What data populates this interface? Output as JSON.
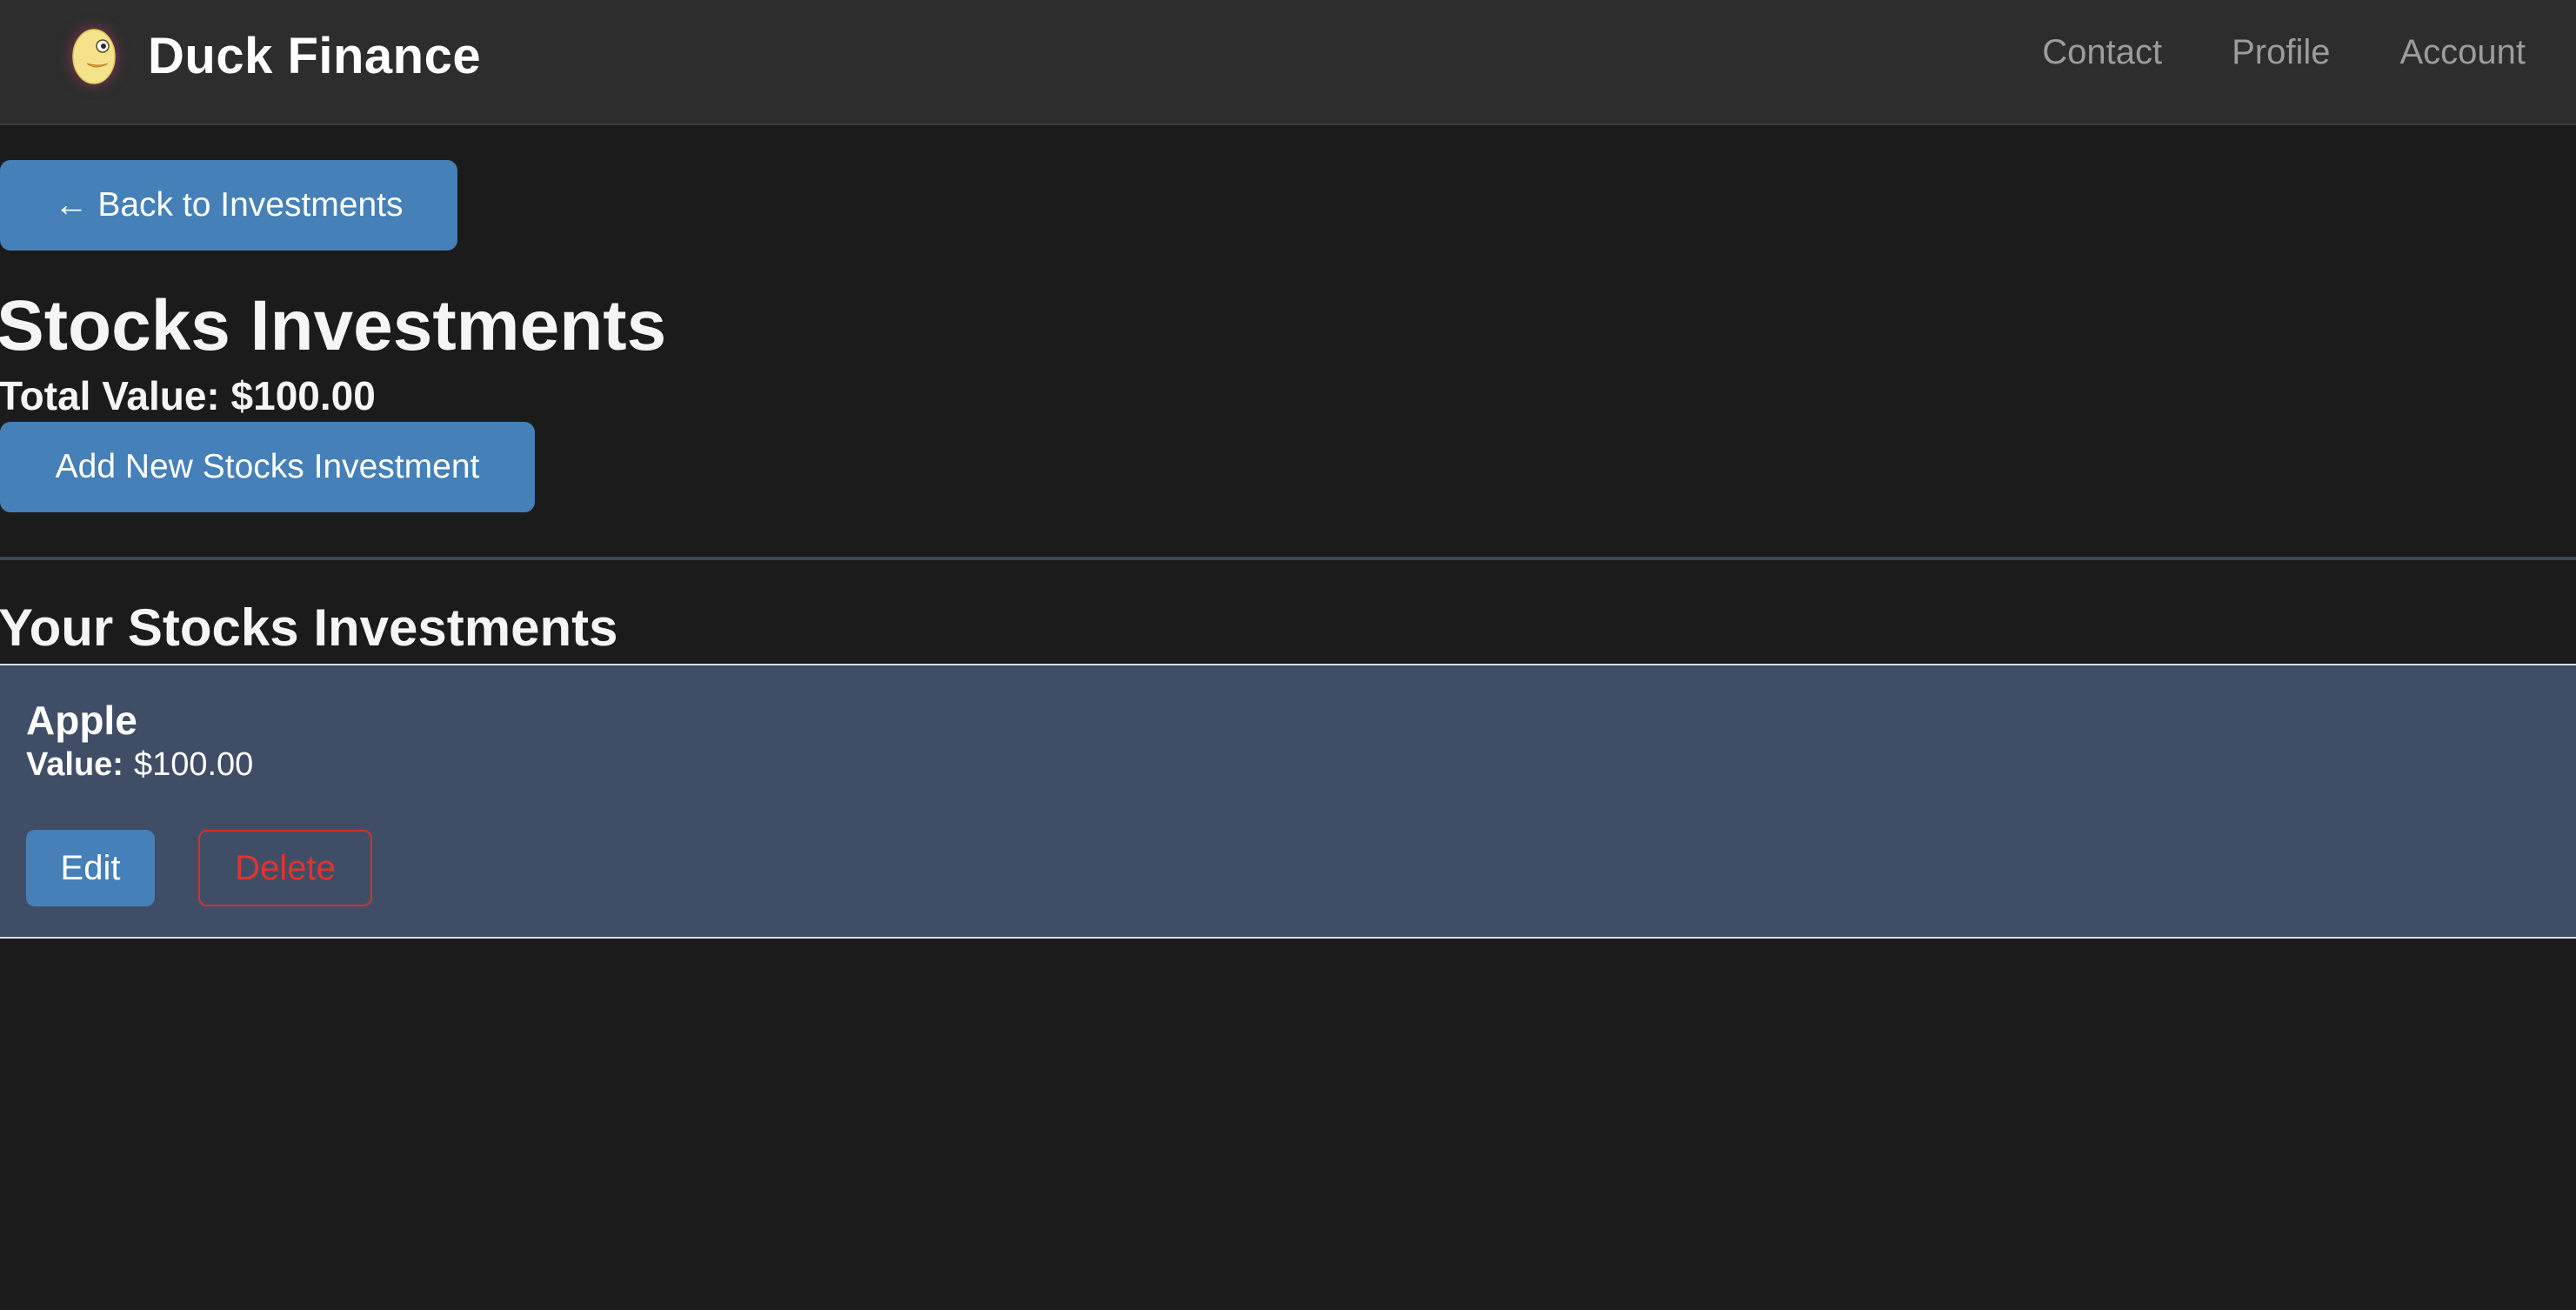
{
  "navbar": {
    "brand_name": "Duck Finance",
    "logo_icon": "duck-logo-icon",
    "links": [
      "Contact",
      "Profile",
      "Account"
    ]
  },
  "back_button": {
    "label": "← Back to Investments"
  },
  "page": {
    "title": "Stocks Investments",
    "total_value": "Total Value: $100.00",
    "add_button_label": "Add New Stocks Investment"
  },
  "list": {
    "title": "Your Stocks Investments",
    "items": [
      {
        "name": "Apple",
        "value_label": "Value:",
        "value": "$100.00",
        "edit_label": "Edit",
        "delete_label": "Delete"
      }
    ]
  },
  "colors": {
    "background": "#1b1b1b",
    "navbar": "#2d2d2d",
    "primary_button": "#4580b8",
    "card": "#3f4e66",
    "danger": "#e0342e"
  }
}
